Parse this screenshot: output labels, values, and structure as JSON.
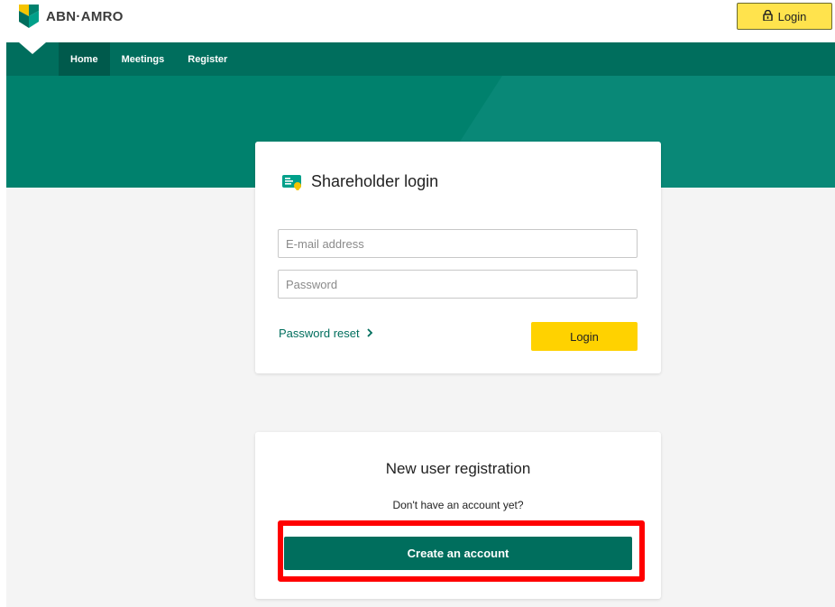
{
  "header": {
    "logo_text": "ABN·AMRO",
    "login_label": "Login",
    "login_icon": "lock-icon"
  },
  "nav": {
    "items": [
      {
        "label": "Home",
        "active": true
      },
      {
        "label": "Meetings",
        "active": false
      },
      {
        "label": "Register",
        "active": false
      }
    ]
  },
  "login_card": {
    "title": "Shareholder login",
    "title_icon": "id-card-icon",
    "email_placeholder": "E-mail address",
    "password_placeholder": "Password",
    "password_reset_label": "Password reset",
    "login_button": "Login"
  },
  "registration_card": {
    "title": "New user registration",
    "subtitle": "Don't have an account yet?",
    "create_button": "Create an account"
  },
  "colors": {
    "brand_green": "#006e5d",
    "brand_yellow": "#ffd200",
    "highlight_red": "#ff0000"
  }
}
